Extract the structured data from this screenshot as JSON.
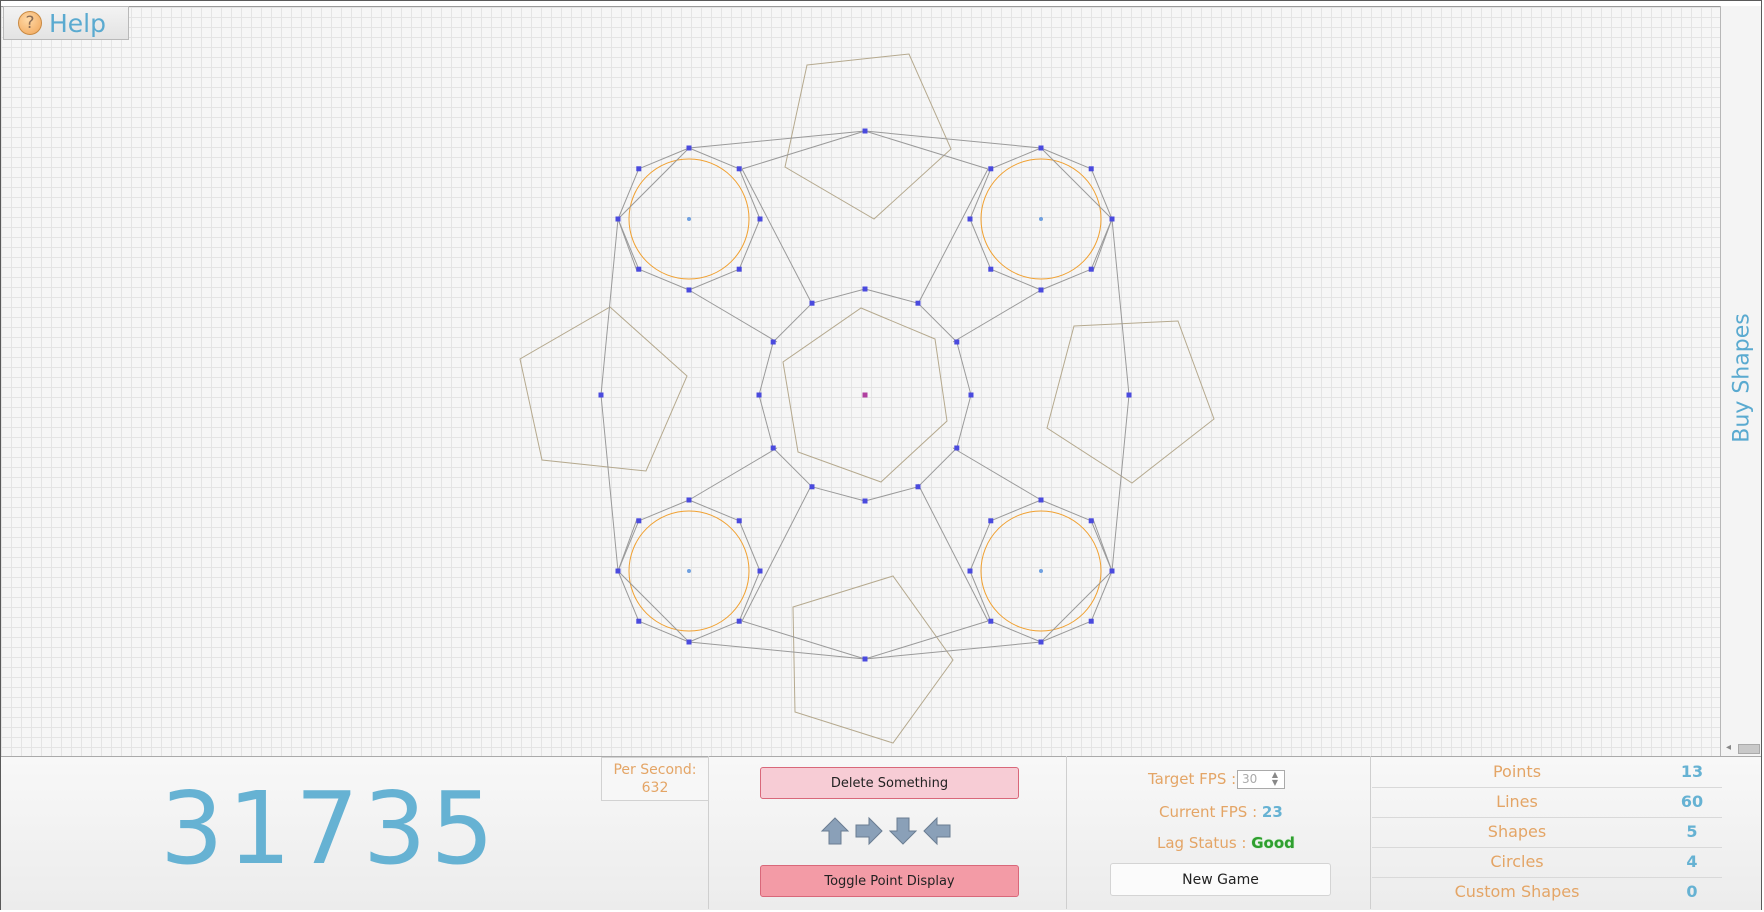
{
  "help": {
    "label": "Help",
    "icon": "question-icon"
  },
  "side_panel": {
    "label": "Buy Shapes"
  },
  "score": "31735",
  "per_second": {
    "label": "Per Second:",
    "value": "632"
  },
  "controls": {
    "delete_label": "Delete Something",
    "toggle_label": "Toggle Point Display",
    "arrows": [
      "arrow-up-icon",
      "arrow-right-icon",
      "arrow-down-icon",
      "arrow-left-icon"
    ]
  },
  "fps": {
    "target_label": "Target FPS :",
    "target_value": "30",
    "current_label": "Current FPS :",
    "current_value": "23",
    "lag_label": "Lag Status :",
    "lag_value": "Good"
  },
  "new_game_label": "New Game",
  "stats": [
    {
      "label": "Points",
      "value": "13"
    },
    {
      "label": "Lines",
      "value": "60"
    },
    {
      "label": "Shapes",
      "value": "5"
    },
    {
      "label": "Circles",
      "value": "4"
    },
    {
      "label": "Custom Shapes",
      "value": "0"
    }
  ],
  "colors": {
    "accent_blue": "#5aaad0",
    "accent_orange": "#e4a566",
    "point_blue": "#4a4ade",
    "circle_orange": "#f0a030",
    "line_gray": "#9a9a9a",
    "lag_good": "#2f9f2f"
  }
}
